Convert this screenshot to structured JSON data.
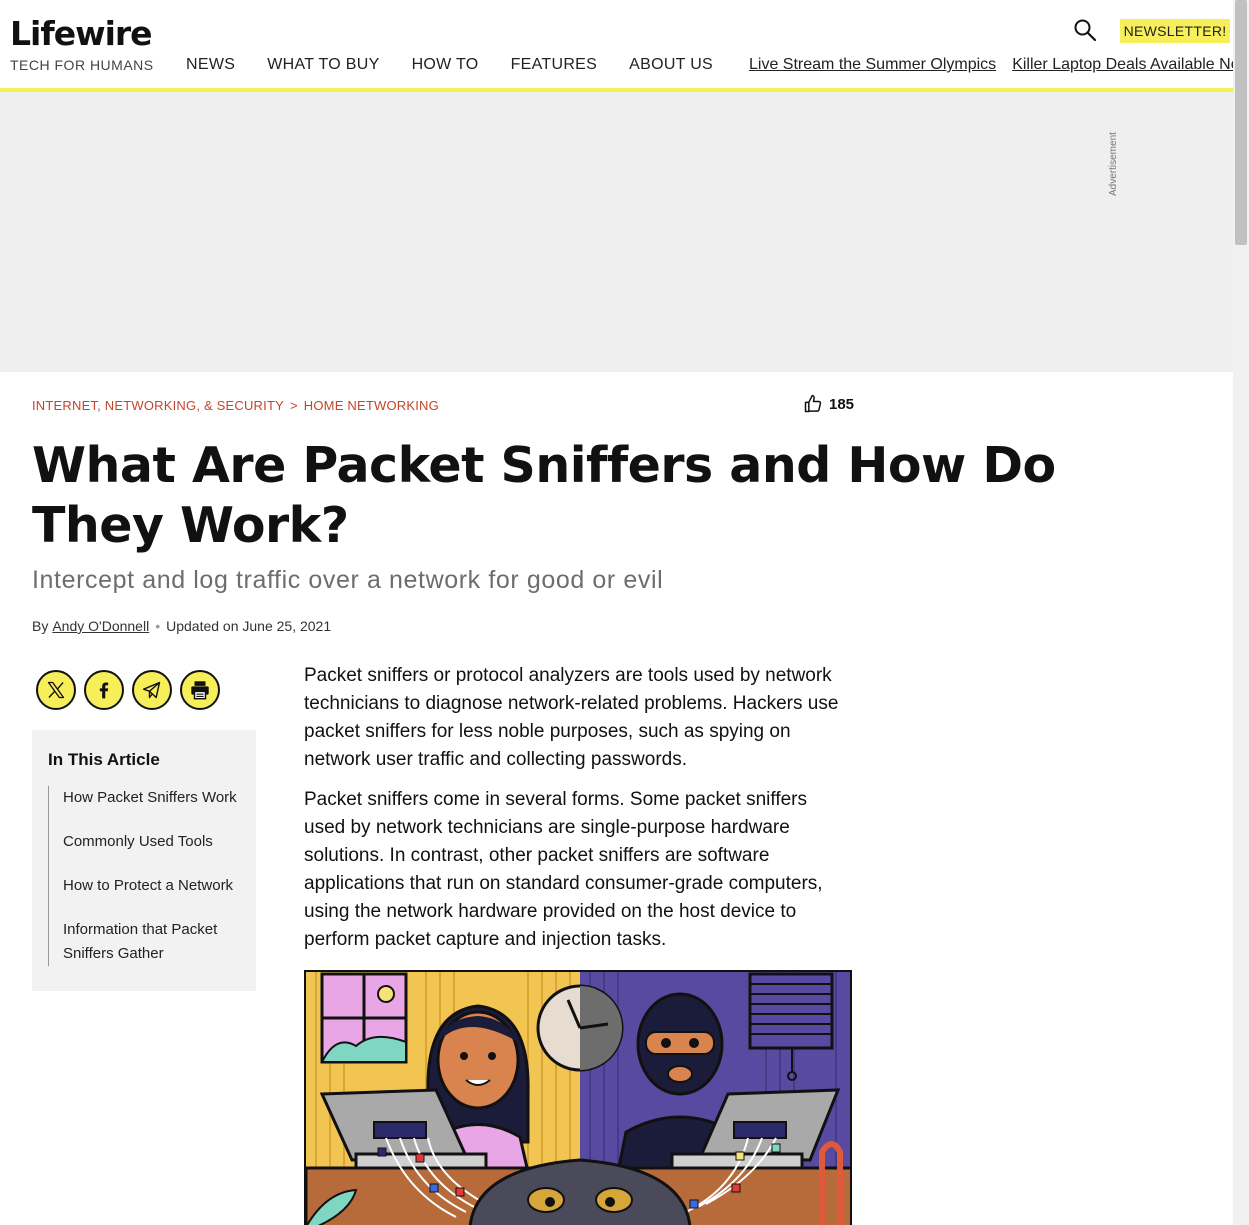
{
  "header": {
    "logo": "Lifewire",
    "tagline": "TECH FOR HUMANS",
    "nav": [
      "NEWS",
      "WHAT TO BUY",
      "HOW TO",
      "FEATURES",
      "ABOUT US"
    ],
    "trending": [
      "Live Stream the Summer Olympics",
      "Killer Laptop Deals Available Now"
    ],
    "newsletter_label": "NEWSLETTER!",
    "search_icon": "search-icon",
    "accent_color": "#f6ef5a"
  },
  "ad": {
    "label": "Advertisement"
  },
  "article": {
    "breadcrumb": [
      "INTERNET, NETWORKING, & SECURITY",
      "HOME NETWORKING"
    ],
    "breadcrumb_separator": ">",
    "likes": "185",
    "title": "What Are Packet Sniffers and How Do They Work?",
    "subtitle": "Intercept and log traffic over a network for good or evil",
    "byline_prefix": "By",
    "author": "Andy O'Donnell",
    "byline_dot": "•",
    "updated": "Updated on June 25, 2021",
    "paragraphs": [
      "Packet sniffers or protocol analyzers are tools used by network technicians to diagnose network-related problems. Hackers use packet sniffers for less noble purposes, such as spying on network user traffic and collecting passwords.",
      "Packet sniffers come in several forms. Some packet sniffers used by network technicians are single-purpose hardware solutions. In contrast, other packet sniffers are software applications that run on standard consumer-grade computers, using the network hardware provided on the host device to perform packet capture and injection tasks."
    ],
    "breadcrumb_color": "#c5452a"
  },
  "share": {
    "icons": [
      "x-icon",
      "facebook-icon",
      "email-send-icon",
      "print-icon"
    ]
  },
  "toc": {
    "title": "In This Article",
    "items": [
      "How Packet Sniffers Work",
      "Commonly Used Tools",
      "How to Protect a Network",
      "Information that Packet Sniffers Gather"
    ]
  }
}
